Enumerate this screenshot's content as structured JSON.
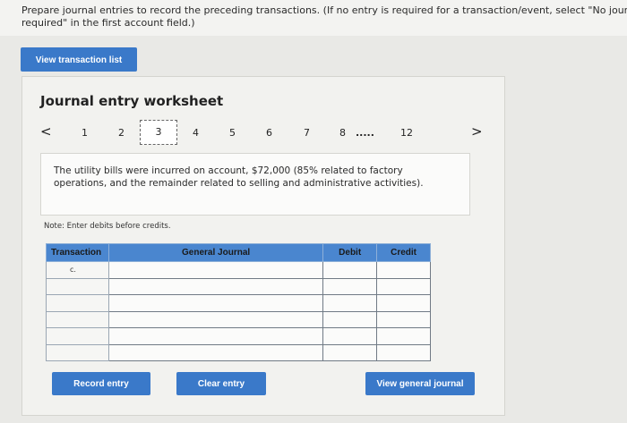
{
  "instructions": {
    "line1": "Prepare journal entries to record the preceding transactions. (If no entry is required for a transaction/event, select \"No journal entry",
    "line2": "required\" in the first account field.)"
  },
  "buttons": {
    "view_transaction_list": "View transaction list",
    "record_entry": "Record entry",
    "clear_entry": "Clear entry",
    "view_general_journal": "View general journal"
  },
  "worksheet": {
    "title": "Journal entry worksheet",
    "pager": {
      "prev": "<",
      "next": ">",
      "steps": [
        "1",
        "2",
        "3",
        "4",
        "5",
        "6",
        "7",
        "8"
      ],
      "ellipsis": ".....",
      "last": "12",
      "active": "3"
    },
    "description": {
      "line1": "The utility bills were incurred on account, $72,000 (85% related to factory",
      "line2": "operations, and the remainder related to selling and administrative activities)."
    },
    "note": "Note: Enter debits before credits.",
    "table": {
      "headers": {
        "transaction": "Transaction",
        "general_journal": "General Journal",
        "debit": "Debit",
        "credit": "Credit"
      },
      "first_transaction": "c."
    }
  },
  "colors": {
    "accent": "#3a79c9",
    "header": "#4a86cf"
  }
}
